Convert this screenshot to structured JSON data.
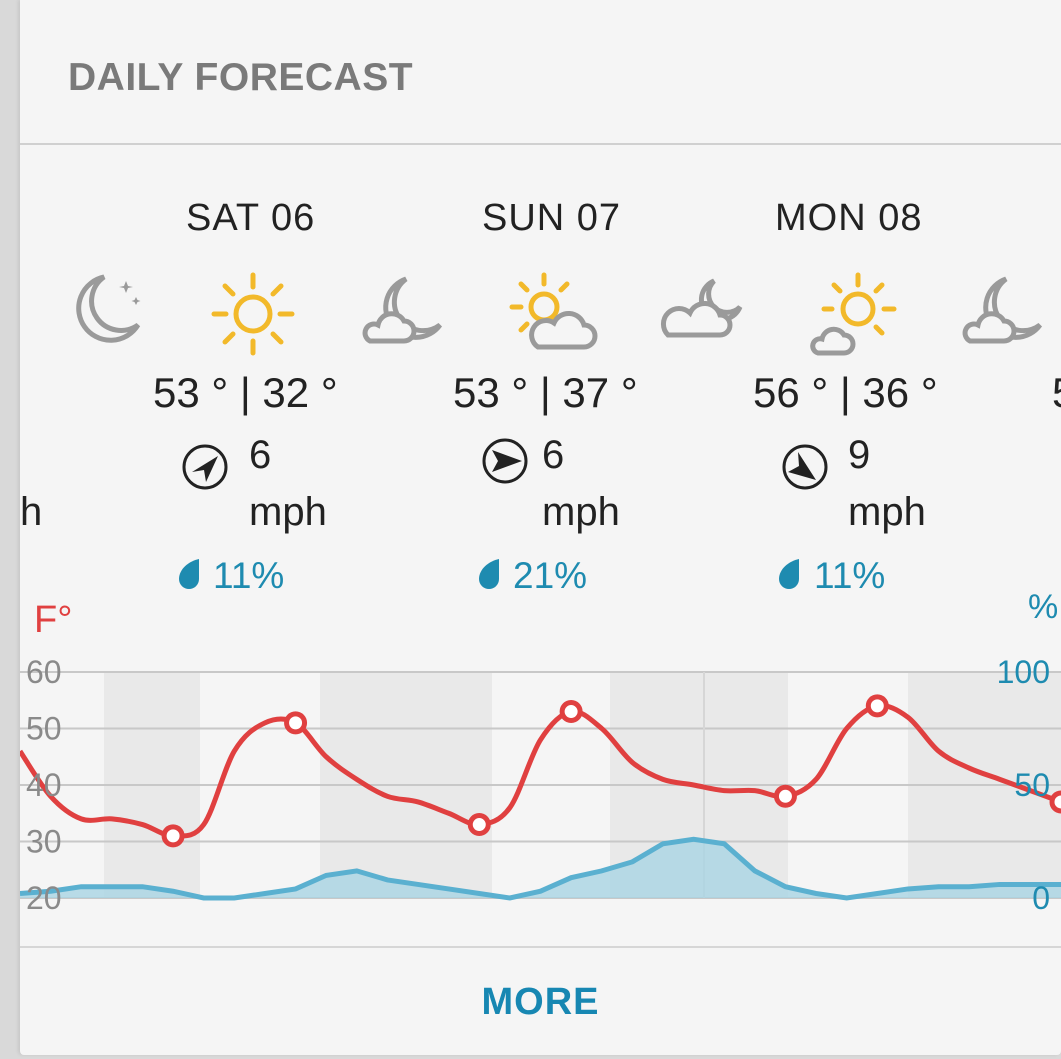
{
  "header": {
    "title": "DAILY FORECAST"
  },
  "forecast": {
    "partial_left": {
      "temp": "° ",
      "wind_unit": "h"
    },
    "days": [
      {
        "label": "SAT  06",
        "icon_day": "sun-icon",
        "icon_night": "moon-cloud-icon",
        "temps": "53 ° | 32 °",
        "wind_speed": "6",
        "wind_unit": "mph",
        "wind_direction": "northeast",
        "precip": "11%"
      },
      {
        "label": "SUN  07",
        "icon_day": "sun-cloud-icon",
        "icon_night": "moon-cloud-icon",
        "temps": "53 ° | 37 °",
        "wind_speed": "6",
        "wind_unit": "mph",
        "wind_direction": "east",
        "precip": "21%"
      },
      {
        "label": "MON  08",
        "icon_day": "sun-cloud-icon",
        "icon_night": "moon-cloud-icon",
        "temps": "56 ° | 36 °",
        "wind_speed": "9",
        "wind_unit": "mph",
        "wind_direction": "southeast",
        "precip": "11%"
      }
    ],
    "partial_right": {
      "temp": "5"
    }
  },
  "chart_data": {
    "type": "line",
    "left_axis_label": "F°",
    "right_axis_label": "%",
    "left_ticks": [
      "60",
      "50",
      "40",
      "30",
      "20"
    ],
    "right_ticks": [
      "100",
      "50",
      "0"
    ],
    "ylim_left": [
      20,
      60
    ],
    "ylim_right": [
      0,
      100
    ],
    "series": [
      {
        "name": "temperature",
        "color": "#e04040",
        "unit": "°F",
        "values": [
          46,
          38,
          34,
          34,
          33,
          31,
          33,
          46,
          51,
          51,
          45,
          41,
          38,
          37,
          35,
          33,
          36,
          48,
          53,
          50,
          44,
          41,
          40,
          39,
          39,
          38,
          41,
          50,
          54,
          52,
          46,
          43,
          41,
          39,
          37
        ],
        "markers": [
          {
            "index": 5,
            "value": 31
          },
          {
            "index": 9,
            "value": 51
          },
          {
            "index": 15,
            "value": 33
          },
          {
            "index": 18,
            "value": 53
          },
          {
            "index": 25,
            "value": 38
          },
          {
            "index": 28,
            "value": 54
          },
          {
            "index": 34,
            "value": 37
          }
        ]
      },
      {
        "name": "precipitation",
        "color": "#5ab0d0",
        "unit": "%",
        "values": [
          2,
          3,
          5,
          5,
          5,
          3,
          0,
          0,
          2,
          4,
          10,
          12,
          8,
          6,
          4,
          2,
          0,
          3,
          9,
          12,
          16,
          24,
          26,
          24,
          12,
          5,
          2,
          0,
          2,
          4,
          5,
          5,
          6,
          6,
          6
        ]
      }
    ]
  },
  "footer": {
    "more_label": "MORE"
  }
}
